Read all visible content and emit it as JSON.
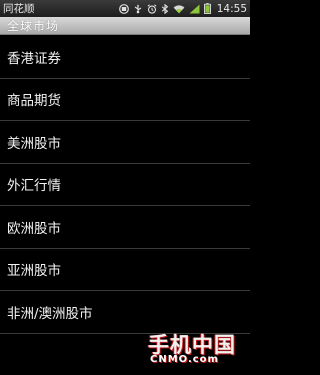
{
  "status_bar": {
    "app_name": "同花顺",
    "time": "14:55",
    "icons": [
      "notification-icon",
      "usb-icon",
      "alarm-icon",
      "bluetooth-icon",
      "wifi-icon",
      "signal-icon",
      "battery-icon"
    ]
  },
  "title_bar": {
    "title": "全球市场"
  },
  "menu": {
    "items": [
      {
        "label": "香港证券"
      },
      {
        "label": "商品期货"
      },
      {
        "label": "美洲股市"
      },
      {
        "label": "外汇行情"
      },
      {
        "label": "欧洲股市"
      },
      {
        "label": "亚洲股市"
      },
      {
        "label": "非洲/澳洲股市"
      }
    ]
  },
  "watermark": {
    "logo_text": "手机中国",
    "logo_sub": "CNMO.com"
  },
  "colors": {
    "background": "#000000",
    "title_bar": "#bdbdbd",
    "accent": "#c21d1d"
  }
}
